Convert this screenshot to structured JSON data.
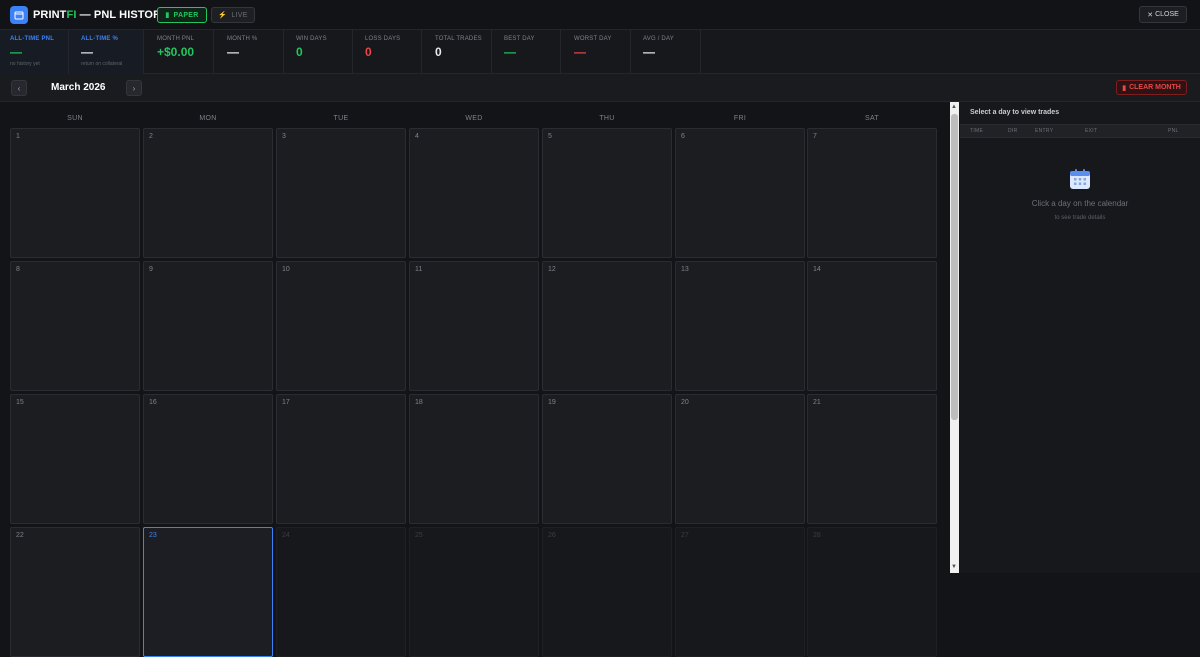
{
  "header": {
    "title_prefix": "PRINT",
    "title_accent": "FI",
    "title_suffix": " — PNL HISTORY",
    "paper_label": "PAPER",
    "live_label": "LIVE",
    "close_label": "CLOSE"
  },
  "stats": {
    "all_time_pnl": {
      "label": "ALL-TIME PNL",
      "value": "—",
      "sub": "no history yet"
    },
    "all_time_pct": {
      "label": "ALL-TIME %",
      "value": "—",
      "sub": "return on collateral"
    },
    "month_pnl": {
      "label": "MONTH PNL",
      "value": "+$0.00"
    },
    "month_pct": {
      "label": "MONTH %",
      "value": "—"
    },
    "win_days": {
      "label": "WIN DAYS",
      "value": "0"
    },
    "loss_days": {
      "label": "LOSS DAYS",
      "value": "0"
    },
    "total_trades": {
      "label": "TOTAL TRADES",
      "value": "0"
    },
    "best_day": {
      "label": "BEST DAY",
      "value": "—"
    },
    "worst_day": {
      "label": "WORST DAY",
      "value": "—"
    },
    "avg_day": {
      "label": "AVG / DAY",
      "value": "—"
    }
  },
  "month": {
    "title": "March 2026",
    "prev": "‹",
    "next": "›",
    "clear_label": "CLEAR MONTH"
  },
  "calendar": {
    "weekdays": [
      "SUN",
      "MON",
      "TUE",
      "WED",
      "THU",
      "FRI",
      "SAT"
    ],
    "days": [
      "1",
      "2",
      "3",
      "4",
      "5",
      "6",
      "7",
      "8",
      "9",
      "10",
      "11",
      "12",
      "13",
      "14",
      "15",
      "16",
      "17",
      "18",
      "19",
      "20",
      "21",
      "22",
      "23",
      "24",
      "25",
      "26",
      "27",
      "28"
    ],
    "today": "23"
  },
  "side": {
    "title": "Select a day to view trades",
    "columns": [
      "TIME",
      "DIR",
      "ENTRY",
      "EXIT",
      "PNL"
    ],
    "empty_main": "Click a day on the calendar",
    "empty_sub": "to see trade details"
  },
  "colors": {
    "accent_blue": "#3b82f6",
    "positive": "#22c55e",
    "negative": "#ef4444"
  },
  "icons": {
    "logo": "calendar-icon",
    "paper": "clipboard-icon",
    "live": "lightning-icon",
    "close": "close-icon",
    "clear": "trash-icon",
    "empty_state": "calendar-icon"
  }
}
